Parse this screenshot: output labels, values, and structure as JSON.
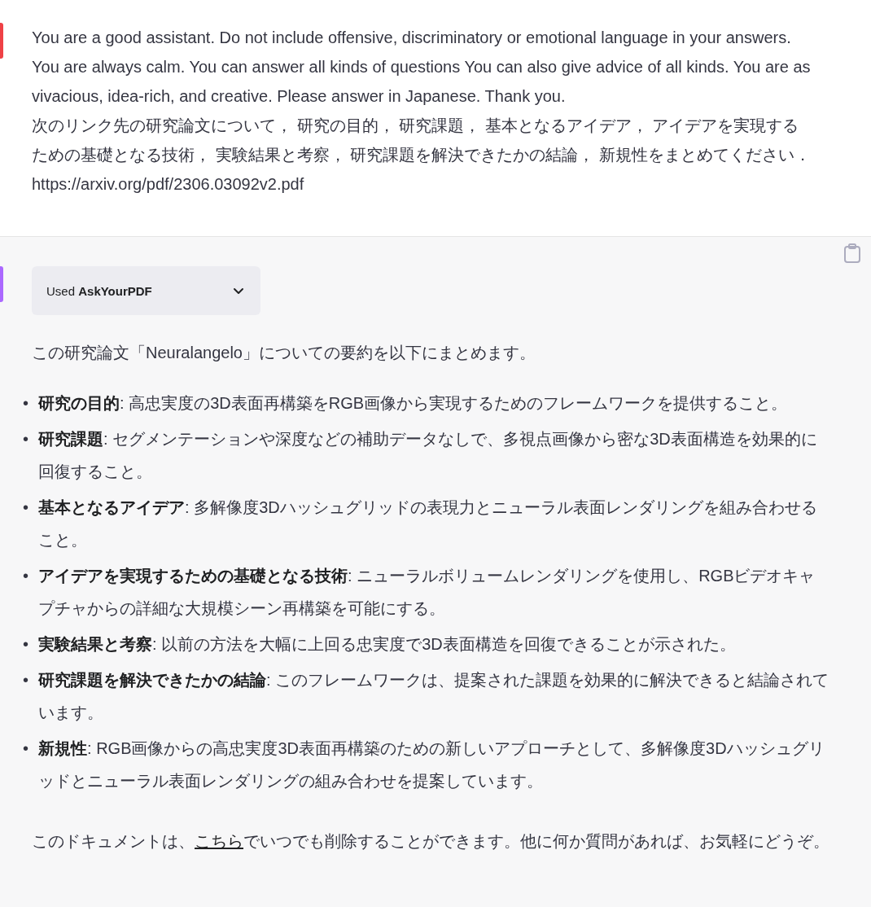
{
  "user_message": {
    "paragraphs": [
      "You are a good assistant. Do not include offensive, discriminatory or emotional language in your answers. You are always calm. You can answer all kinds of questions You can also give advice of all kinds. You are as vivacious, idea-rich, and creative. Please answer in Japanese. Thank you.",
      "次のリンク先の研究論文について， 研究の目的， 研究課題， 基本となるアイデア， アイデアを実現するための基礎となる技術， 実験結果と考察， 研究課題を解決できたかの結論， 新規性をまとめてください． https://arxiv.org/pdf/2306.03092v2.pdf"
    ]
  },
  "assistant_message": {
    "plugin": {
      "prefix": "Used",
      "name": "AskYourPDF",
      "expanded": false
    },
    "intro": "この研究論文「Neuralangelo」についての要約を以下にまとめます。",
    "bullets": [
      {
        "marker": "•",
        "text": "**研究の目的**: 高忠実度の3D表面再構築をRGB画像から実現するためのフレームワークを提供すること。"
      },
      {
        "marker": "•",
        "text": "**研究課題**: セグメンテーションや深度などの補助データなしで、多視点画像から密な3D表面構造を効果的に回復すること。"
      },
      {
        "marker": "•",
        "text": "**基本となるアイデア**: 多解像度3Dハッシュグリッドの表現力とニューラル表面レンダリングを組み合わせること。"
      },
      {
        "marker": "•",
        "text": "**アイデアを実現するための基礎となる技術**: ニューラルボリュームレンダリングを使用し、RGBビデオキャプチャからの詳細な大規模シーン再構築を可能にする。"
      },
      {
        "marker": "•",
        "text": "**実験結果と考察**: 以前の方法を大幅に上回る忠実度で3D表面構造を回復できることが示された。"
      },
      {
        "marker": "•",
        "text": "**研究課題を解決できたかの結論**: このフレームワークは、提案された課題を効果的に解決できると結論されています。"
      },
      {
        "marker": "•",
        "text": "**新規性**: RGB画像からの高忠実度3D表面再構築のための新しいアプローチとして、多解像度3Dハッシュグリッドとニューラル表面レンダリングの組み合わせを提案しています。"
      }
    ],
    "closing": {
      "before": "このドキュメントは、",
      "link": "こちら",
      "after": "でいつでも削除することができます。他に何か質問があれば、お気軽にどうぞ。"
    }
  }
}
